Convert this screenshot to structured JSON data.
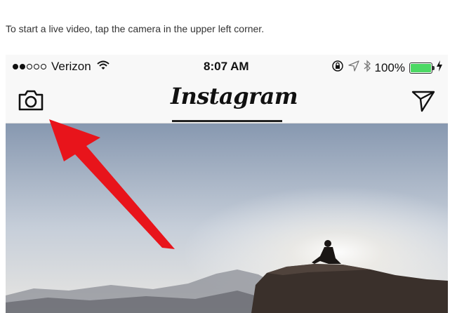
{
  "caption": "To start a live video, tap the camera in the upper left corner.",
  "status_bar": {
    "signal_bars_filled": 2,
    "signal_bars_total": 5,
    "carrier": "Verizon",
    "time": "8:07 AM",
    "battery_percent": "100%",
    "battery_level": 1.0,
    "battery_color": "#4cd964",
    "icons": [
      "wifi-icon",
      "orientation-lock-icon",
      "location-icon",
      "bluetooth-icon",
      "battery-icon",
      "charging-icon"
    ]
  },
  "nav": {
    "left_icon": "camera-icon",
    "title": "Instagram",
    "right_icon": "direct-message-icon"
  },
  "annotation": {
    "arrow_color": "#e8141b"
  }
}
